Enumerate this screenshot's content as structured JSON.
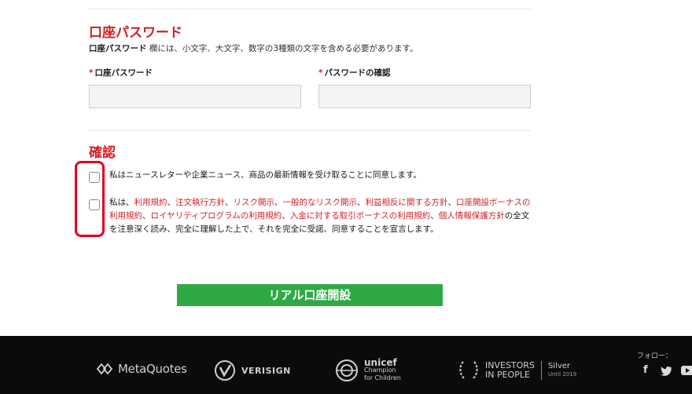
{
  "password_section": {
    "title": "口座パスワード",
    "desc_bold": "口座パスワード",
    "desc_rest": " 欄には、小文字、大文字、数字の3種類の文字を含める必要があります。",
    "required_mark": "*",
    "password_label": "口座パスワード",
    "confirm_label": "パスワードの確認",
    "password_value": "",
    "confirm_value": ""
  },
  "confirm_section": {
    "title": "確認",
    "newsletter_text": "私はニュースレターや企業ニュース、商品の最新情報を受け取ることに同意します。",
    "terms_prefix": "私は、",
    "links": [
      "利用規約",
      "注文執行方針",
      "リスク開示",
      "一般的なリスク開示",
      "利益相反に関する方針",
      "口座開設ボーナスの利用規約",
      "ロイヤリティプログラムの利用規約",
      "入金に対する取引ボーナスの利用規約",
      "個人情報保護方針"
    ],
    "sep": "、",
    "terms_suffix": "の全文を注意深く読み、完全に理解した上で、それを完全に受諾、同意することを宣言します。",
    "newsletter_checked": false,
    "terms_checked": false
  },
  "submit_label": "リアル口座開設",
  "footer": {
    "follow_label": "フォロー：",
    "logos": {
      "metaquotes": "MetaQuotes",
      "verisign": "VERISIGN",
      "unicef_name": "unicef",
      "unicef_line1": "Champion",
      "unicef_line2": "for Children",
      "iip_line1": "INVESTORS",
      "iip_line2": "IN PEOPLE",
      "iip_level": "Silver",
      "iip_until": "Until 2019"
    },
    "social": {
      "facebook": "f",
      "twitter": "t"
    }
  },
  "colors": {
    "accent_red": "#d21f26",
    "button_green": "#2eaa45",
    "highlight": "#e3001b",
    "footer_bg": "#0b0b0b"
  }
}
